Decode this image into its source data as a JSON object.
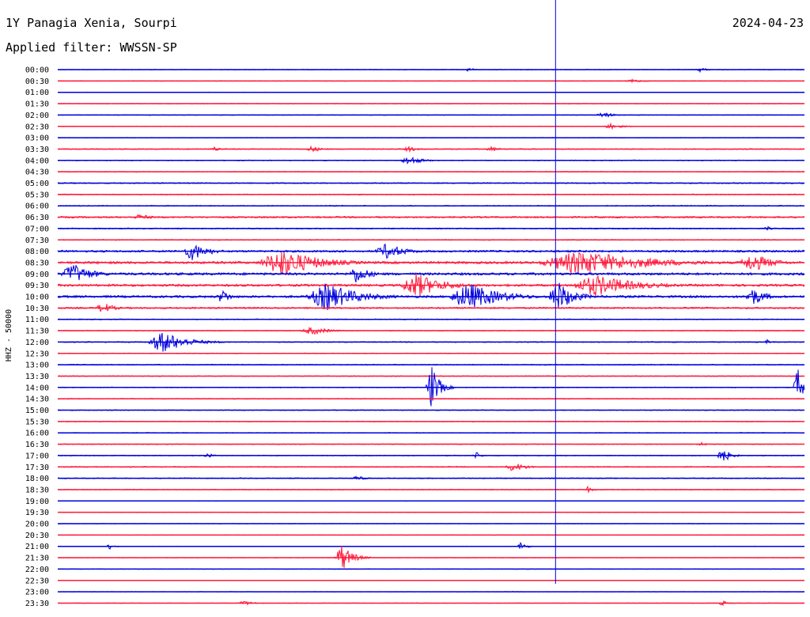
{
  "header": {
    "station": "1Y Panagia Xenia, Sourpi",
    "date": "2024-04-23",
    "filter": "Applied filter: WWSSN-SP"
  },
  "chart_data": {
    "type": "line",
    "subtype": "helicorder",
    "ylabel": "HHZ - 50000",
    "row_labels": [
      "00:00",
      "00:30",
      "01:00",
      "01:30",
      "02:00",
      "02:30",
      "03:00",
      "03:30",
      "04:00",
      "04:30",
      "05:00",
      "05:30",
      "06:00",
      "06:30",
      "07:00",
      "07:30",
      "08:00",
      "08:30",
      "09:00",
      "09:30",
      "10:00",
      "10:30",
      "11:00",
      "11:30",
      "12:00",
      "12:30",
      "13:00",
      "13:30",
      "14:00",
      "14:30",
      "15:00",
      "15:30",
      "16:00",
      "16:30",
      "17:00",
      "17:30",
      "18:00",
      "18:30",
      "19:00",
      "19:30",
      "20:00",
      "20:30",
      "21:00",
      "21:30",
      "22:00",
      "22:30",
      "23:00",
      "23:30"
    ],
    "row_minutes": 30,
    "colors": {
      "even": "#0000dd",
      "odd": "#ff1a3c",
      "marker": "#0000dd"
    },
    "current_time_marker": "10:50",
    "noise_level": [
      0.4,
      0.4,
      0.3,
      0.4,
      0.4,
      0.4,
      0.3,
      0.6,
      0.5,
      0.5,
      0.7,
      0.6,
      0.6,
      1.0,
      0.7,
      0.6,
      1.2,
      1.5,
      1.5,
      1.4,
      1.4,
      1.0,
      0.6,
      0.5,
      0.6,
      0.5,
      0.6,
      0.5,
      0.5,
      0.5,
      0.5,
      0.5,
      0.5,
      0.5,
      0.5,
      0.6,
      0.6,
      0.5,
      0.3,
      0.3,
      0.3,
      0.3,
      0.3,
      0.3,
      0.3,
      0.3,
      0.3,
      0.3
    ],
    "events": [
      {
        "row": 0,
        "pos": 0.55,
        "amp": 3,
        "dur": 0.02
      },
      {
        "row": 0,
        "pos": 0.86,
        "amp": 3,
        "dur": 0.03
      },
      {
        "row": 1,
        "pos": 0.77,
        "amp": 2,
        "dur": 0.05
      },
      {
        "row": 4,
        "pos": 0.73,
        "amp": 4,
        "dur": 0.04
      },
      {
        "row": 5,
        "pos": 0.74,
        "amp": 4,
        "dur": 0.04
      },
      {
        "row": 7,
        "pos": 0.21,
        "amp": 3,
        "dur": 0.03
      },
      {
        "row": 7,
        "pos": 0.34,
        "amp": 4,
        "dur": 0.04
      },
      {
        "row": 7,
        "pos": 0.47,
        "amp": 4,
        "dur": 0.03
      },
      {
        "row": 7,
        "pos": 0.58,
        "amp": 4,
        "dur": 0.03
      },
      {
        "row": 8,
        "pos": 0.47,
        "amp": 6,
        "dur": 0.05
      },
      {
        "row": 13,
        "pos": 0.11,
        "amp": 4,
        "dur": 0.05
      },
      {
        "row": 14,
        "pos": 0.95,
        "amp": 3,
        "dur": 0.02
      },
      {
        "row": 16,
        "pos": 0.18,
        "amp": 12,
        "dur": 0.06
      },
      {
        "row": 16,
        "pos": 0.44,
        "amp": 10,
        "dur": 0.07
      },
      {
        "row": 17,
        "pos": 0.3,
        "amp": 18,
        "dur": 0.14
      },
      {
        "row": 17,
        "pos": 0.7,
        "amp": 16,
        "dur": 0.25
      },
      {
        "row": 17,
        "pos": 0.93,
        "amp": 12,
        "dur": 0.08
      },
      {
        "row": 18,
        "pos": 0.02,
        "amp": 14,
        "dur": 0.07
      },
      {
        "row": 18,
        "pos": 0.4,
        "amp": 12,
        "dur": 0.05
      },
      {
        "row": 19,
        "pos": 0.48,
        "amp": 16,
        "dur": 0.1
      },
      {
        "row": 19,
        "pos": 0.72,
        "amp": 14,
        "dur": 0.15
      },
      {
        "row": 20,
        "pos": 0.22,
        "amp": 10,
        "dur": 0.03
      },
      {
        "row": 20,
        "pos": 0.36,
        "amp": 18,
        "dur": 0.12
      },
      {
        "row": 20,
        "pos": 0.55,
        "amp": 18,
        "dur": 0.12
      },
      {
        "row": 20,
        "pos": 0.67,
        "amp": 20,
        "dur": 0.06
      },
      {
        "row": 20,
        "pos": 0.93,
        "amp": 12,
        "dur": 0.05
      },
      {
        "row": 21,
        "pos": 0.06,
        "amp": 8,
        "dur": 0.04
      },
      {
        "row": 23,
        "pos": 0.34,
        "amp": 5,
        "dur": 0.07
      },
      {
        "row": 24,
        "pos": 0.14,
        "amp": 14,
        "dur": 0.09
      },
      {
        "row": 24,
        "pos": 0.95,
        "amp": 3,
        "dur": 0.02
      },
      {
        "row": 28,
        "pos": 0.5,
        "amp": 30,
        "dur": 0.03
      },
      {
        "row": 28,
        "pos": 0.99,
        "amp": 30,
        "dur": 0.02
      },
      {
        "row": 33,
        "pos": 0.86,
        "amp": 4,
        "dur": 0.02
      },
      {
        "row": 34,
        "pos": 0.2,
        "amp": 4,
        "dur": 0.02
      },
      {
        "row": 34,
        "pos": 0.89,
        "amp": 10,
        "dur": 0.03
      },
      {
        "row": 34,
        "pos": 0.56,
        "amp": 5,
        "dur": 0.02
      },
      {
        "row": 35,
        "pos": 0.61,
        "amp": 6,
        "dur": 0.05
      },
      {
        "row": 36,
        "pos": 0.4,
        "amp": 3,
        "dur": 0.04
      },
      {
        "row": 37,
        "pos": 0.71,
        "amp": 4,
        "dur": 0.02
      },
      {
        "row": 42,
        "pos": 0.07,
        "amp": 4,
        "dur": 0.02
      },
      {
        "row": 42,
        "pos": 0.62,
        "amp": 6,
        "dur": 0.02
      },
      {
        "row": 43,
        "pos": 0.38,
        "amp": 18,
        "dur": 0.04
      },
      {
        "row": 47,
        "pos": 0.25,
        "amp": 3,
        "dur": 0.04
      },
      {
        "row": 47,
        "pos": 0.89,
        "amp": 4,
        "dur": 0.02
      }
    ]
  }
}
